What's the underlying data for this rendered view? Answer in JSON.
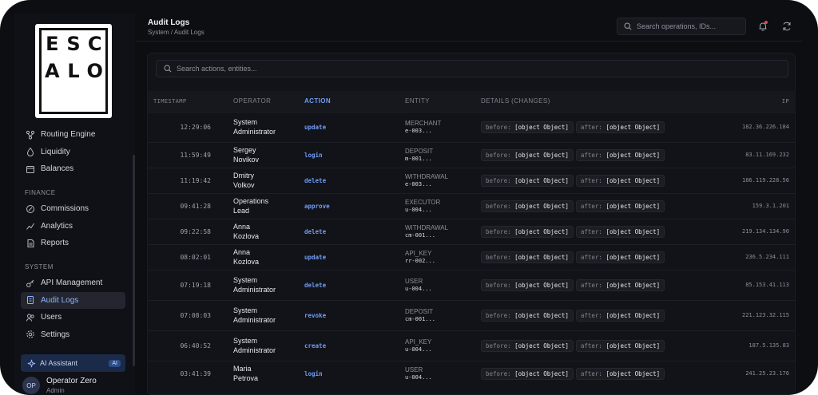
{
  "sidebar": {
    "logo_letters": [
      "E",
      "S",
      "C",
      "A",
      "L",
      "O"
    ],
    "items_top": [
      {
        "label": "Routing Engine",
        "icon": "routing-icon"
      },
      {
        "label": "Liquidity",
        "icon": "liquidity-icon"
      },
      {
        "label": "Balances",
        "icon": "wallet-icon"
      }
    ],
    "finance_section": "FINANCE",
    "items_finance": [
      {
        "label": "Commissions",
        "icon": "percent-icon"
      },
      {
        "label": "Analytics",
        "icon": "chart-icon"
      },
      {
        "label": "Reports",
        "icon": "report-icon"
      }
    ],
    "system_section": "SYSTEM",
    "items_system": [
      {
        "label": "API Management",
        "icon": "key-icon"
      },
      {
        "label": "Audit Logs",
        "icon": "audit-icon",
        "active": true
      },
      {
        "label": "Users",
        "icon": "users-icon"
      },
      {
        "label": "Settings",
        "icon": "gear-icon"
      }
    ],
    "ai_assistant": {
      "label": "AI Assistant",
      "badge": "AI"
    },
    "user": {
      "initials": "OP",
      "name": "Operator Zero",
      "role": "Admin"
    }
  },
  "header": {
    "title": "Audit Logs",
    "breadcrumb": "System / Audit Logs",
    "search_placeholder": "Search operations, IDs..."
  },
  "main": {
    "search_placeholder": "Search actions, entities...",
    "columns": {
      "timestamp": "TIMESTAMP",
      "operator": "OPERATOR",
      "action": "ACTION",
      "entity": "ENTITY",
      "details": "DETAILS (CHANGES)",
      "ip": "IP"
    },
    "before_label": "before:",
    "after_label": "after:",
    "rows": [
      {
        "time": "12:29:06",
        "operator": "System Administrator",
        "action": "update",
        "entity_type": "MERCHANT",
        "entity_id": "e-003...",
        "before": "[object Object]",
        "after": "[object Object]",
        "ip": "182.36.226.184"
      },
      {
        "time": "11:59:49",
        "operator": "Sergey Novikov",
        "action": "login",
        "entity_type": "DEPOSIT",
        "entity_id": "m-001...",
        "before": "[object Object]",
        "after": "[object Object]",
        "ip": "83.11.169.232"
      },
      {
        "time": "11:19:42",
        "operator": "Dmitry Volkov",
        "action": "delete",
        "entity_type": "WITHDRAWAL",
        "entity_id": "e-003...",
        "before": "[object Object]",
        "after": "[object Object]",
        "ip": "186.119.228.56"
      },
      {
        "time": "09:41:28",
        "operator": "Operations Lead",
        "action": "approve",
        "entity_type": "EXECUTOR",
        "entity_id": "u-004...",
        "before": "[object Object]",
        "after": "[object Object]",
        "ip": "159.3.1.201"
      },
      {
        "time": "09:22:58",
        "operator": "Anna Kozlova",
        "action": "delete",
        "entity_type": "WITHDRAWAL",
        "entity_id": "cm-001...",
        "before": "[object Object]",
        "after": "[object Object]",
        "ip": "219.134.134.90"
      },
      {
        "time": "08:02:01",
        "operator": "Anna Kozlova",
        "action": "update",
        "entity_type": "API_KEY",
        "entity_id": "rr-002...",
        "before": "[object Object]",
        "after": "[object Object]",
        "ip": "236.5.234.111"
      },
      {
        "time": "07:19:18",
        "operator": "System Administrator",
        "action": "delete",
        "entity_type": "USER",
        "entity_id": "u-004...",
        "before": "[object Object]",
        "after": "[object Object]",
        "ip": "85.153.41.113"
      },
      {
        "time": "07:08:03",
        "operator": "System Administrator",
        "action": "revoke",
        "entity_type": "DEPOSIT",
        "entity_id": "cm-001...",
        "before": "[object Object]",
        "after": "[object Object]",
        "ip": "221.123.32.115"
      },
      {
        "time": "06:40:52",
        "operator": "System Administrator",
        "action": "create",
        "entity_type": "API_KEY",
        "entity_id": "u-004...",
        "before": "[object Object]",
        "after": "[object Object]",
        "ip": "187.5.135.83"
      },
      {
        "time": "03:41:39",
        "operator": "Maria Petrova",
        "action": "login",
        "entity_type": "USER",
        "entity_id": "u-004...",
        "before": "[object Object]",
        "after": "[object Object]",
        "ip": "241.25.23.176"
      }
    ]
  }
}
